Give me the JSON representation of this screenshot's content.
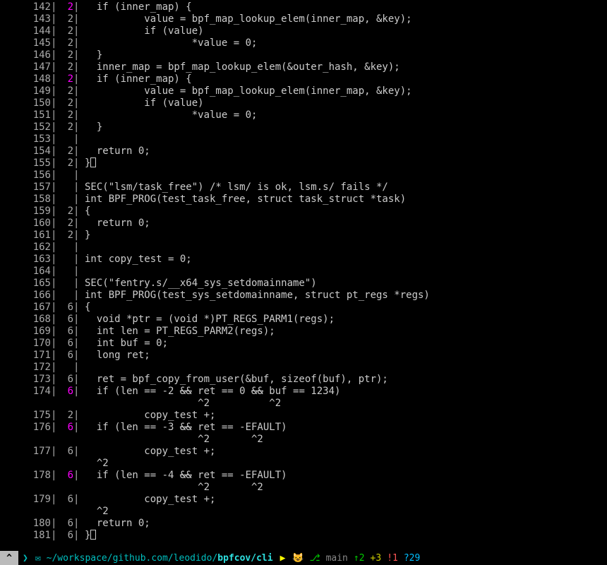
{
  "status": {
    "icon": "^",
    "mail_icon": "✉",
    "path_prefix": "~/workspace/github.com/leodido/",
    "path_bold": "bpfcov/cli",
    "triangle": "▶",
    "git_icon": "😺",
    "branch_icon": "⎇",
    "branch": "main",
    "ahead": "↑2",
    "plus": "+3",
    "excl": "!1",
    "quest": "?29"
  },
  "lines": [
    {
      "n": "142",
      "c": "2",
      "p": true,
      "code": "  if (inner_map) {"
    },
    {
      "n": "143",
      "c": "2",
      "code": "          value = bpf_map_lookup_elem(inner_map, &key);"
    },
    {
      "n": "144",
      "c": "2",
      "code": "          if (value)"
    },
    {
      "n": "145",
      "c": "2",
      "code": "                  *value = 0;"
    },
    {
      "n": "146",
      "c": "2",
      "code": "  }"
    },
    {
      "n": "147",
      "c": "2",
      "code": "  inner_map = bpf_map_lookup_elem(&outer_hash, &key);"
    },
    {
      "n": "148",
      "c": "2",
      "p": true,
      "code": "  if (inner_map) {"
    },
    {
      "n": "149",
      "c": "2",
      "code": "          value = bpf_map_lookup_elem(inner_map, &key);"
    },
    {
      "n": "150",
      "c": "2",
      "code": "          if (value)"
    },
    {
      "n": "151",
      "c": "2",
      "code": "                  *value = 0;"
    },
    {
      "n": "152",
      "c": "2",
      "code": "  }"
    },
    {
      "n": "153",
      "c": "",
      "code": ""
    },
    {
      "n": "154",
      "c": "2",
      "code": "  return 0;"
    },
    {
      "n": "155",
      "c": "2",
      "code": "}",
      "cursor": true
    },
    {
      "n": "156",
      "c": "",
      "code": ""
    },
    {
      "n": "157",
      "c": "",
      "code": "SEC(\"lsm/task_free\") /* lsm/ is ok, lsm.s/ fails */"
    },
    {
      "n": "158",
      "c": "",
      "code": "int BPF_PROG(test_task_free, struct task_struct *task)"
    },
    {
      "n": "159",
      "c": "2",
      "code": "{"
    },
    {
      "n": "160",
      "c": "2",
      "code": "  return 0;"
    },
    {
      "n": "161",
      "c": "2",
      "code": "}"
    },
    {
      "n": "162",
      "c": "",
      "code": ""
    },
    {
      "n": "163",
      "c": "",
      "code": "int copy_test = 0;"
    },
    {
      "n": "164",
      "c": "",
      "code": ""
    },
    {
      "n": "165",
      "c": "",
      "code": "SEC(\"fentry.s/__x64_sys_setdomainname\")"
    },
    {
      "n": "166",
      "c": "",
      "code": "int BPF_PROG(test_sys_setdomainname, struct pt_regs *regs)"
    },
    {
      "n": "167",
      "c": "6",
      "code": "{"
    },
    {
      "n": "168",
      "c": "6",
      "code": "  void *ptr = (void *)PT_REGS_PARM1(regs);"
    },
    {
      "n": "169",
      "c": "6",
      "code": "  int len = PT_REGS_PARM2(regs);"
    },
    {
      "n": "170",
      "c": "6",
      "code": "  int buf = 0;"
    },
    {
      "n": "171",
      "c": "6",
      "code": "  long ret;"
    },
    {
      "n": "172",
      "c": "",
      "code": ""
    },
    {
      "n": "173",
      "c": "6",
      "code": "  ret = bpf_copy_from_user(&buf, sizeof(buf), ptr);"
    },
    {
      "n": "174",
      "c": "6",
      "p": true,
      "code": "  if (len == -2 && ret == 0 && buf == 1234)",
      "sub": "                   ^2          ^2"
    },
    {
      "n": "175",
      "c": "2",
      "code": "          copy_test +;"
    },
    {
      "n": "176",
      "c": "6",
      "p": true,
      "code": "  if (len == -3 && ret == -EFAULT)",
      "sub": "                   ^2       ^2"
    },
    {
      "n": "177",
      "c": "6",
      "code": "          copy_test +;",
      "sub": "  ^2"
    },
    {
      "n": "178",
      "c": "6",
      "p": true,
      "code": "  if (len == -4 && ret == -EFAULT)",
      "sub": "                   ^2       ^2"
    },
    {
      "n": "179",
      "c": "6",
      "code": "          copy_test +;",
      "sub": "  ^2"
    },
    {
      "n": "180",
      "c": "6",
      "code": "  return 0;"
    },
    {
      "n": "181",
      "c": "6",
      "code": "}",
      "cursor": true
    }
  ]
}
